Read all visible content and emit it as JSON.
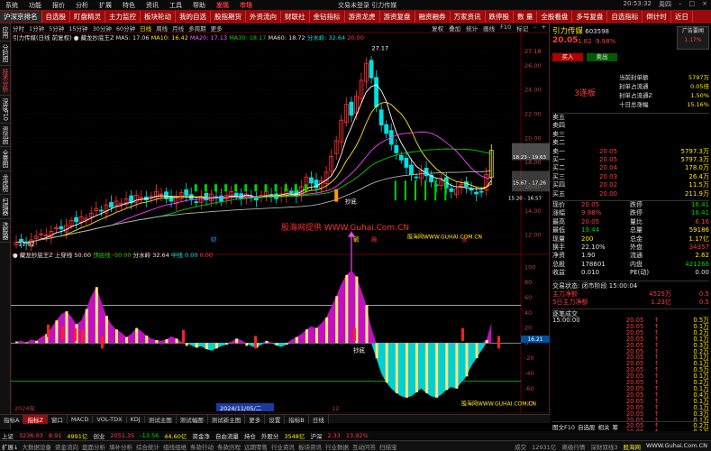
{
  "menubar": {
    "items": [
      "系统",
      "功能",
      "报价",
      "分析",
      "扩展",
      "特色",
      "资讯",
      "工具",
      "帮助"
    ],
    "highlight": "发现",
    "market": "市场",
    "center": "交易未登录  引力传媒",
    "time": "20:53:32",
    "week": "周四"
  },
  "toolbar": [
    "沪深京排名",
    "自选股",
    "盯盘精灵",
    "主力监控",
    "板块轮动",
    "我的自选",
    "股指期货",
    "外资流向",
    "财联社",
    "金钻指标",
    "游资龙虎",
    "游资复盘",
    "融资融券",
    "万家资讯",
    "跌停股",
    "数 量",
    "全股看盘",
    "多号复盘",
    "自选指标",
    "倒计时",
    "近日"
  ],
  "left_tabs": [
    "应用",
    "分时图",
    "技术分析",
    "深度F10",
    "资讯面",
    "全景图",
    "龙虎榜",
    "扫描器",
    "选股器"
  ],
  "periods": {
    "items": [
      "分时",
      "1分钟",
      "5分钟",
      "15分钟",
      "30分钟",
      "60分钟",
      "日线",
      "周线",
      "月线",
      "多周期",
      "更多"
    ],
    "active": "日线",
    "right": [
      "复权",
      "叠加",
      "统计",
      "画线",
      "F10",
      "标记",
      "-",
      "+"
    ]
  },
  "main_legend": {
    "name": "引力传媒(日线 前复权)",
    "ind": "● 藏龙抄底王Z",
    "ma5": "MA5: 17.06",
    "ma10": "MA10: 16.42",
    "ma20": "MA20: 17.13",
    "ma30": "MA30: 18.17",
    "ma60": "MA60: 18.72",
    "fx": "分水岭: 32.64",
    "v": "20.00"
  },
  "sub_legend": {
    "name": "● 藏龙抄底王Z",
    "v1": "上穿线 50.00",
    "v2": "顶底线 -50.00",
    "v3": "分水岭 32.64",
    "v4": "中线 0.00",
    "v5": "0.00"
  },
  "price_axis": [
    "27.18",
    "26.00",
    "24.00",
    "22.00",
    "20.00",
    "18.00",
    "16.00",
    "14.00",
    "12.00"
  ],
  "sub_axis": [
    "100",
    "80",
    "60",
    "40",
    "20",
    "0",
    "-20",
    "-40",
    "-60",
    "-80"
  ],
  "annotations": {
    "high": "27.17",
    "low": "11.02",
    "buy1": "抄底",
    "buy2": "抄底",
    "watermark": "股海网提供  WWW.Guhai.Com.CN",
    "wm2": "股海网WWW.GUHAI.COM.CN",
    "wm3": "股海网WWW.GUHAI.COM.CN",
    "range1": "18.23 - 19.63",
    "range2": "15.67 - 17.26",
    "range3": "15.20 - 16.57",
    "sub_high": "16.21",
    "bar_val": "14.40",
    "tag1": "财",
    "tag2": "额",
    "tag3": "融",
    "tag4": "涨"
  },
  "x_axis": {
    "l1": "2024年",
    "l2": "2024/11/05/二",
    "l3": "12"
  },
  "right_panel": {
    "title": "引力传媒",
    "code": "603598",
    "price": "20.05",
    "chg": "1.82",
    "pct": "9.98%",
    "btn_buy": "买入",
    "btn_sell": "卖出",
    "tag_ad": "广告要闻",
    "ad_v": "1.17%",
    "limit": "3连板",
    "info": [
      [
        "当前封单额",
        "5797万"
      ],
      [
        "封单占流通",
        "0.05倍"
      ],
      [
        "封单占流通Z",
        "1.50%"
      ],
      [
        "十日总涨幅",
        "15.16%"
      ]
    ],
    "asks": [
      [
        "卖五",
        "",
        ""
      ],
      [
        "卖四",
        "",
        ""
      ],
      [
        "卖三",
        "",
        ""
      ],
      [
        "卖二",
        "",
        ""
      ],
      [
        "卖一",
        "20.05",
        "5797.3万"
      ]
    ],
    "bids": [
      [
        "买一",
        "20.05",
        "5797.3万"
      ],
      [
        "买二",
        "20.04",
        "178.0万"
      ],
      [
        "买三",
        "20.03",
        "26.4万"
      ],
      [
        "买四",
        "20.02",
        "11.5万"
      ],
      [
        "买五",
        "20.00",
        "211.9万"
      ]
    ],
    "stats": [
      [
        "现价",
        "20.05",
        "跌停",
        "16.41"
      ],
      [
        "涨幅",
        "9.98%",
        "跌停",
        "16.41"
      ],
      [
        "最高",
        "20.05",
        "量比",
        "6.16"
      ],
      [
        "最低",
        "19.44",
        "总量",
        "59186"
      ],
      [
        "现量",
        "200",
        "总金",
        "1.17亿"
      ],
      [
        "换手",
        "22.10%",
        "外盘",
        "34357"
      ],
      [
        "净资",
        "1.90",
        "流通",
        "2.62"
      ],
      [
        "总股",
        "178601",
        "内盘",
        "421266"
      ],
      [
        "收益",
        "0.010",
        "PE(动)",
        "0.00"
      ]
    ],
    "status": "交易状态: 闭市阶段   15:00:04",
    "flow": [
      [
        "主力净额",
        "4525万",
        "0.5"
      ],
      [
        "5日主力净额",
        "1.23亿",
        "0.5"
      ]
    ],
    "ticks_title": "逐笔成交",
    "ticks": [
      [
        "15:00:00",
        "20.05",
        "0.5万"
      ],
      [
        "",
        "20.05",
        "0.1万"
      ],
      [
        "",
        "20.05",
        "0.2万"
      ],
      [
        "",
        "20.05",
        "0.1万"
      ],
      [
        "",
        "20.05",
        "0.3万"
      ],
      [
        "",
        "20.05",
        "0.2万"
      ],
      [
        "",
        "20.05",
        "0.1万"
      ],
      [
        "",
        "20.05",
        "0.1万"
      ],
      [
        "",
        "20.05",
        "0.5万"
      ],
      [
        "",
        "20.05",
        "0.1万"
      ],
      [
        "",
        "20.05",
        "0.2万"
      ],
      [
        "",
        "20.05",
        "0.1万"
      ],
      [
        "",
        "20.05",
        "0.4万"
      ],
      [
        "",
        "20.05",
        "0.1万"
      ],
      [
        "",
        "20.05",
        "0.1万"
      ],
      [
        "",
        "20.05",
        "0.3万"
      ],
      [
        "",
        "20.05",
        "0.1万"
      ],
      [
        "",
        "20.05",
        "0.2万"
      ],
      [
        "",
        "20.05",
        "0.1万"
      ],
      [
        "",
        "20.05",
        "0.1万"
      ],
      [
        "",
        "20.05",
        "0.5万"
      ],
      [
        "",
        "20.05",
        "0.1万"
      ],
      [
        "",
        "20.05",
        "0.1万"
      ],
      [
        "",
        "20.05",
        "0.2万"
      ]
    ],
    "bottom_tabs": [
      "图文F10",
      "自选股",
      "相关",
      "筹"
    ]
  },
  "bottom_tabs": [
    "指标A",
    "指标Z",
    "窗口",
    "MACD",
    "VOL-TDX",
    "KDJ",
    "测试主图",
    "测试幅图",
    "测试新主图",
    "更多",
    "设置",
    "指标B",
    "日线"
  ],
  "ticker": [
    "上证",
    "3236.03",
    "8.91",
    "4991亿",
    "创业",
    "2051.35",
    "-13.56",
    "44.60亿",
    "资金净",
    "自由流量",
    "持仓",
    "外股分",
    "3548亿",
    "沪深",
    "2.33",
    "13.92%"
  ],
  "status": [
    [
      "扩展↓",
      "wh"
    ],
    [
      "大数据设备",
      "gr"
    ],
    [
      "资金流向",
      "gr"
    ],
    [
      "盘面分析",
      "gr"
    ],
    [
      "填补分析",
      "gr"
    ],
    [
      "综合统计",
      "gr"
    ],
    [
      "组线组维",
      "gr"
    ],
    [
      "条款行动",
      "gr"
    ],
    [
      "条款历程",
      "gr"
    ],
    [
      "远期零售",
      "gr"
    ],
    [
      "行业资讯",
      "gr"
    ],
    [
      "板块资讯",
      "gr"
    ],
    [
      "行业数据",
      "gr"
    ],
    [
      "互动问答",
      "gr"
    ],
    [
      "扫描宝",
      "gr"
    ]
  ],
  "status_right": [
    "成交",
    "12931亿",
    "离级行情",
    "深财双线3",
    "股海网",
    "WWW.Guhai.Com.CN"
  ],
  "colors": {
    "red": "#ff3b3b",
    "green": "#00d200",
    "cyan": "#00e0e0",
    "magenta": "#d010d0",
    "yellow": "#ffea00",
    "toolbar": "#9a0a0a"
  }
}
